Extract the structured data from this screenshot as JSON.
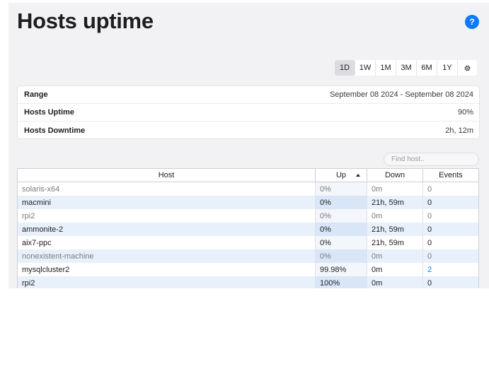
{
  "page": {
    "title": "Hosts uptime",
    "help_label": "?"
  },
  "ranges": [
    {
      "label": "1D",
      "active": true
    },
    {
      "label": "1W",
      "active": false
    },
    {
      "label": "1M",
      "active": false
    },
    {
      "label": "3M",
      "active": false
    },
    {
      "label": "6M",
      "active": false
    },
    {
      "label": "1Y",
      "active": false
    }
  ],
  "settings_icon": "gear-icon",
  "summary": {
    "range_label": "Range",
    "range_value": "September 08 2024 - September 08 2024",
    "uptime_label": "Hosts Uptime",
    "uptime_value": "90%",
    "downtime_label": "Hosts Downtime",
    "downtime_value": "2h, 12m"
  },
  "search": {
    "placeholder": "Find host.."
  },
  "table": {
    "columns": [
      "Host",
      "Up",
      "Down",
      "Events"
    ],
    "sort_column": "Up",
    "rows": [
      {
        "host": "solaris-x64",
        "up": "0%",
        "down": "0m",
        "events": "0",
        "muted": true
      },
      {
        "host": "macmini",
        "up": "0%",
        "down": "21h, 59m",
        "events": "0",
        "muted": false
      },
      {
        "host": "rpi2",
        "up": "0%",
        "down": "0m",
        "events": "0",
        "muted": true
      },
      {
        "host": "ammonite-2",
        "up": "0%",
        "down": "21h, 59m",
        "events": "0",
        "muted": false
      },
      {
        "host": "aix7-ppc",
        "up": "0%",
        "down": "21h, 59m",
        "events": "0",
        "muted": false
      },
      {
        "host": "nonexistent-machine",
        "up": "0%",
        "down": "0m",
        "events": "0",
        "muted": true
      },
      {
        "host": "mysqlcluster2",
        "up": "99.98%",
        "down": "0m",
        "events": "2",
        "muted": false
      },
      {
        "host": "rpi2",
        "up": "100%",
        "down": "0m",
        "events": "0",
        "muted": false
      }
    ]
  }
}
